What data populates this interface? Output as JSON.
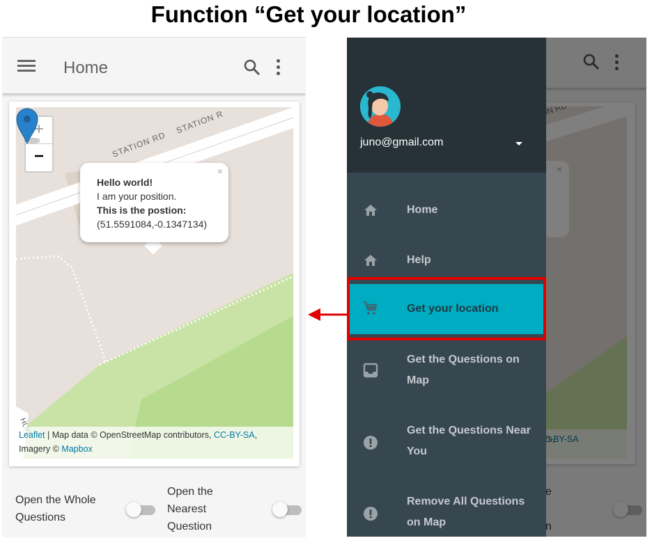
{
  "title": "Function “Get your location”",
  "left": {
    "appbar": {
      "title": "Home"
    },
    "map": {
      "zoom_in": "+",
      "zoom_out": "−",
      "street_1": "STATION RD",
      "street_2": "STATION R",
      "street_3": "HUR",
      "popup": {
        "close": "×",
        "line1": "Hello world!",
        "line2": "I am your position.",
        "line3": "This is the postion:",
        "line4": "(51.5591084,-0.1347134)"
      },
      "attribution": {
        "leaflet": "Leaflet",
        "text1": " | Map data © OpenStreetMap contributors, ",
        "license": "CC-BY-SA",
        "text2": ",",
        "imagery": "Imagery © ",
        "mapbox": "Mapbox"
      }
    },
    "toggles": {
      "whole_line1": "Open the Whole",
      "whole_line2": "Questions",
      "nearest_line1": "Open the",
      "nearest_line2": "Nearest",
      "nearest_line3": "Question"
    }
  },
  "right": {
    "drawer": {
      "email": "juno@gmail.com",
      "items": [
        {
          "label": "Home",
          "icon": "home-icon"
        },
        {
          "label": "Help",
          "icon": "home-icon"
        },
        {
          "label": "Get your location",
          "icon": "cart-icon",
          "active": true
        },
        {
          "label_line1": "Get the Questions on",
          "label_line2": "Map",
          "icon": "inbox-icon"
        },
        {
          "label_line1": "Get the Questions Near",
          "label_line2": "You",
          "icon": "alert-icon"
        },
        {
          "label_line1": "Remove All Questions",
          "label_line2": "on Map",
          "icon": "alert-icon"
        }
      ]
    },
    "behind": {
      "street": "ON RD",
      "popup_close": "×",
      "popup_frag": ")",
      "attr_text": "tors, ",
      "attr_license": "CC-BY-SA",
      "attr_end": ",",
      "toggle_frag1": "he",
      "toggle_frag2": "t",
      "toggle_frag3": "on"
    }
  },
  "colors": {
    "active": "#00acc1",
    "drawer": "#37474f",
    "drawer_header": "#263238",
    "highlight": "#e10000",
    "arrow": "#e10000"
  }
}
